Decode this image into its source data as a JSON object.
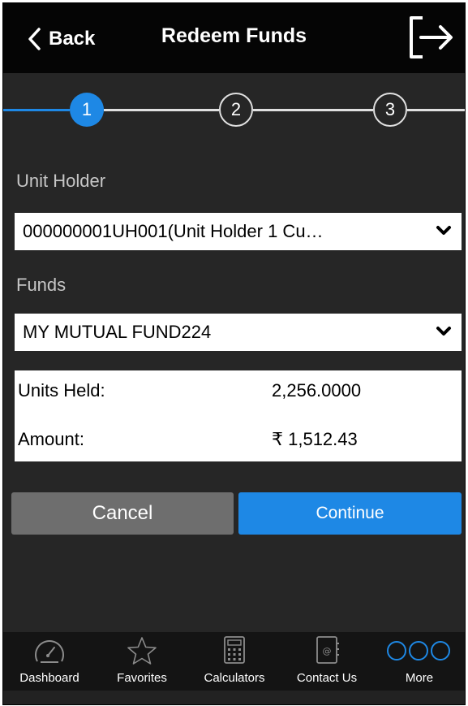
{
  "header": {
    "back_label": "Back",
    "title": "Redeem Funds",
    "back_icon": "chevron-left-icon",
    "logout_icon": "logout-icon"
  },
  "stepper": {
    "steps": [
      {
        "label": "1",
        "state": "active"
      },
      {
        "label": "2",
        "state": "inactive"
      },
      {
        "label": "3",
        "state": "inactive"
      }
    ]
  },
  "form": {
    "unit_holder_label": "Unit Holder",
    "unit_holder_value": "000000001UH001(Unit Holder 1 Cu…",
    "funds_label": "Funds",
    "funds_value": "MY MUTUAL FUND224"
  },
  "summary": {
    "units_held_label": "Units Held:",
    "units_held_value": "2,256.0000",
    "amount_label": "Amount:",
    "amount_value": "₹ 1,512.43"
  },
  "actions": {
    "cancel_label": "Cancel",
    "continue_label": "Continue"
  },
  "tabbar": {
    "tabs": [
      {
        "label": "Dashboard",
        "icon": "speedometer-icon"
      },
      {
        "label": "Favorites",
        "icon": "star-icon"
      },
      {
        "label": "Calculators",
        "icon": "calculator-icon"
      },
      {
        "label": "Contact Us",
        "icon": "contact-book-icon"
      },
      {
        "label": "More",
        "icon": "more-icon"
      }
    ]
  },
  "colors": {
    "accent": "#1e88e5",
    "header_bg": "#050505",
    "screen_bg": "#262626",
    "cancel_bg": "#6e6e6e"
  }
}
